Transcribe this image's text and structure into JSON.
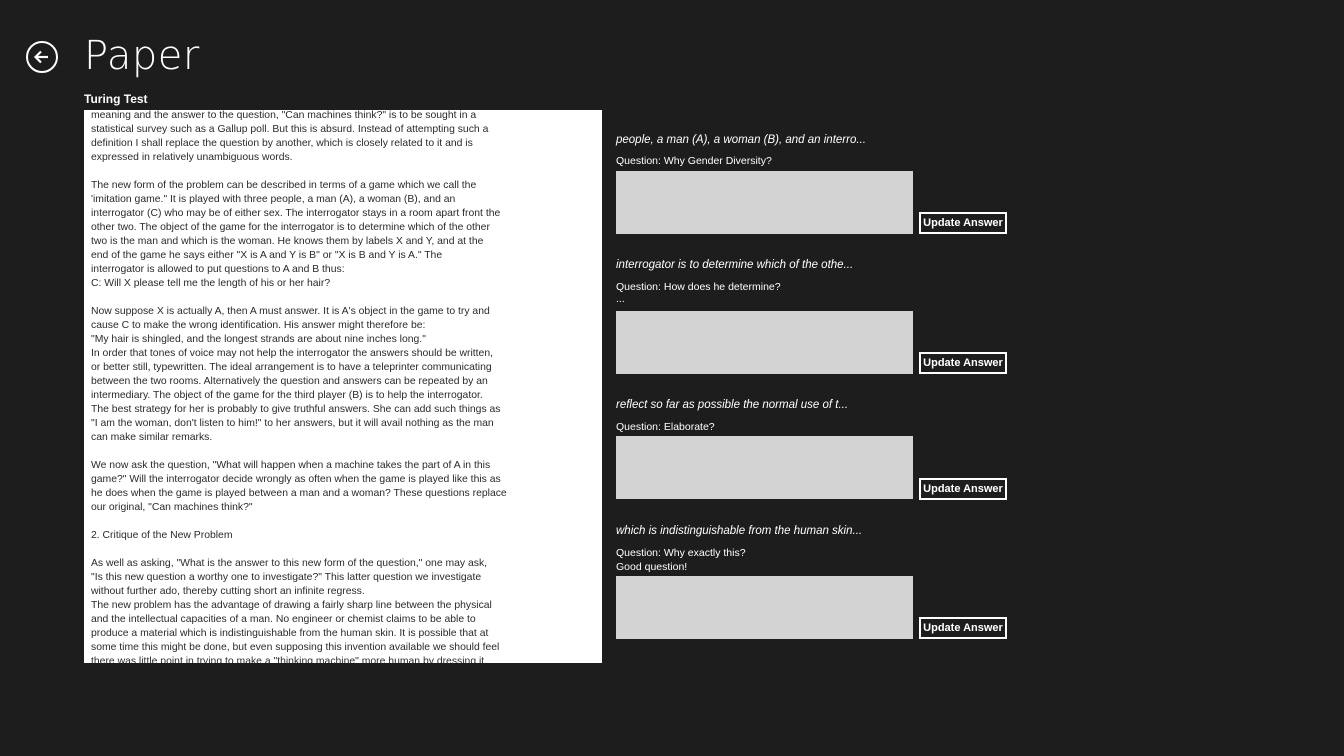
{
  "app": {
    "title": "Paper",
    "back_icon": "back-arrow-icon"
  },
  "document": {
    "title": "Turing Test",
    "text": "meaning and the answer to the question, \"Can machines think?\" is to be sought in a\nstatistical survey such as a Gallup poll. But this is absurd. Instead of attempting such a\ndefinition I shall replace the question by another, which is closely related to it and is\nexpressed in relatively unambiguous words.\n\nThe new form of the problem can be described in terms of a game which we call the\n'imitation game.\" It is played with three people, a man (A), a woman (B), and an\ninterrogator (C) who may be of either sex. The interrogator stays in a room apart front the\nother two. The object of the game for the interrogator is to determine which of the other\ntwo is the man and which is the woman. He knows them by labels X and Y, and at the\nend of the game he says either \"X is A and Y is B\" or \"X is B and Y is A.\" The\ninterrogator is allowed to put questions to A and B thus:\nC: Will X please tell me the length of his or her hair?\n\nNow suppose X is actually A, then A must answer. It is A's object in the game to try and\ncause C to make the wrong identification. His answer might therefore be:\n\"My hair is shingled, and the longest strands are about nine inches long.\"\nIn order that tones of voice may not help the interrogator the answers should be written,\nor better still, typewritten. The ideal arrangement is to have a teleprinter communicating\nbetween the two rooms. Alternatively the question and answers can be repeated by an\nintermediary. The object of the game for the third player (B) is to help the interrogator.\nThe best strategy for her is probably to give truthful answers. She can add such things as\n\"I am the woman, don't listen to him!\" to her answers, but it will avail nothing as the man\ncan make similar remarks.\n\nWe now ask the question, \"What will happen when a machine takes the part of A in this\ngame?\" Will the interrogator decide wrongly as often when the game is played like this as\nhe does when the game is played between a man and a woman? These questions replace\nour original, \"Can machines think?\"\n\n2. Critique of the New Problem\n\nAs well as asking, \"What is the answer to this new form of the question,\" one may ask,\n\"Is this new question a worthy one to investigate?\" This latter question we investigate\nwithout further ado, thereby cutting short an infinite regress.\nThe new problem has the advantage of drawing a fairly sharp line between the physical\nand the intellectual capacities of a man. No engineer or chemist claims to be able to\nproduce a material which is indistinguishable from the human skin. It is possible that at\nsome time this might be done, but even supposing this invention available we should feel\nthere was little point in trying to make a \"thinking machine\" more human by dressing it"
  },
  "annotations": [
    {
      "quote": "people, a man (A), a woman (B), and an interro...",
      "question": "Question: Why Gender Diversity?",
      "previous_answer": "",
      "answer_value": "",
      "button_label": "Update Answer"
    },
    {
      "quote": "interrogator is to determine which of the othe...",
      "question": "Question: How does he determine?",
      "previous_answer": "...",
      "answer_value": "",
      "button_label": "Update Answer"
    },
    {
      "quote": "reflect so far as possible the normal use of t...",
      "question": "Question: Elaborate?",
      "previous_answer": "",
      "answer_value": "",
      "button_label": "Update Answer"
    },
    {
      "quote": "which is indistinguishable from the human skin...",
      "question": "Question: Why exactly this?",
      "previous_answer": "Good question!",
      "answer_value": "",
      "button_label": "Update Answer"
    }
  ],
  "colors": {
    "background": "#1d1d1d",
    "text": "#ffffff",
    "answer_box": "#d3d3d3",
    "document_bg": "#ffffff"
  }
}
